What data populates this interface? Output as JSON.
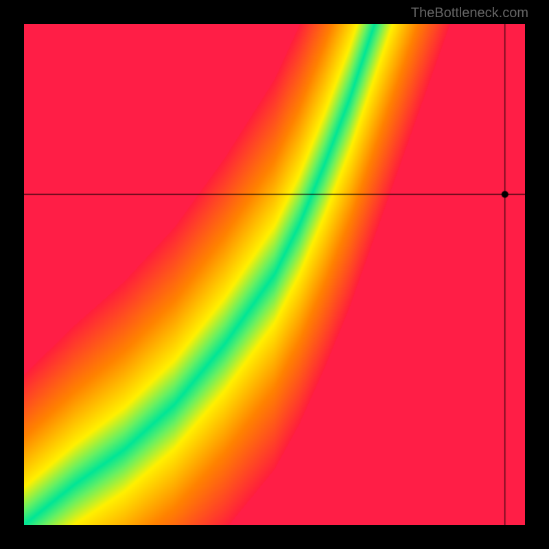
{
  "watermark": "TheBottleneck.com",
  "chart_data": {
    "type": "heatmap",
    "title": "",
    "xlabel": "",
    "ylabel": "",
    "xlim": [
      0,
      100
    ],
    "ylim": [
      0,
      100
    ],
    "crosshair": {
      "x": 96,
      "y": 66
    },
    "marker": {
      "x": 96,
      "y": 66
    },
    "colormap": "red-yellow-green",
    "optimal_curve": [
      {
        "x": 0,
        "y": 0
      },
      {
        "x": 10,
        "y": 8
      },
      {
        "x": 20,
        "y": 15
      },
      {
        "x": 30,
        "y": 24
      },
      {
        "x": 40,
        "y": 36
      },
      {
        "x": 50,
        "y": 50
      },
      {
        "x": 55,
        "y": 60
      },
      {
        "x": 60,
        "y": 72
      },
      {
        "x": 65,
        "y": 85
      },
      {
        "x": 70,
        "y": 100
      }
    ],
    "description": "Bottleneck heatmap showing optimal balance curve from bottom-left to upper region"
  }
}
